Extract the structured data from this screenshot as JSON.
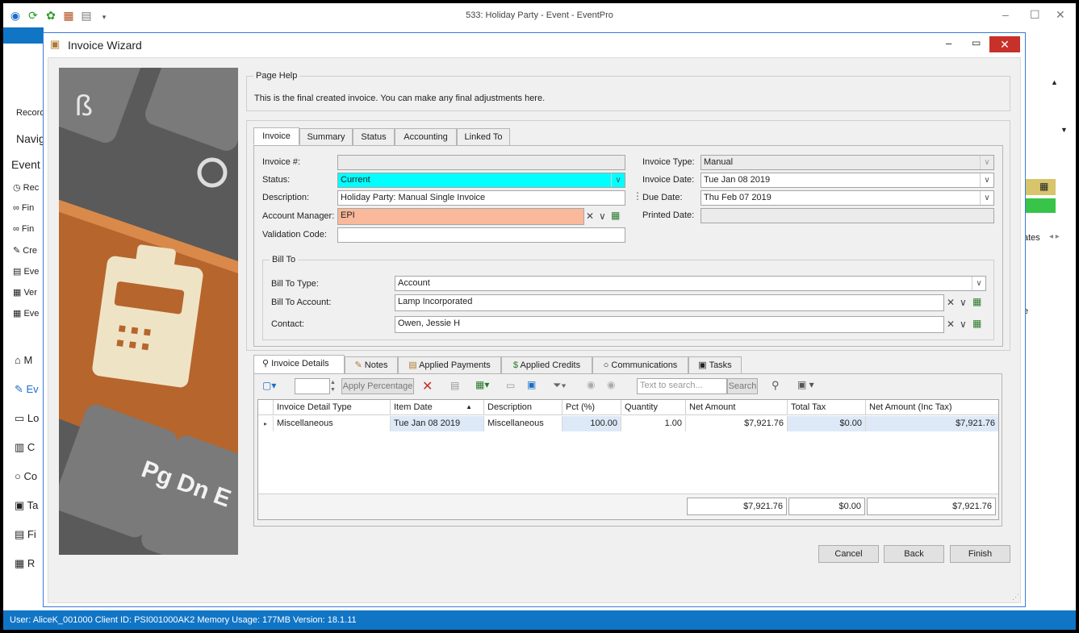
{
  "app": {
    "title": "533: Holiday Party - Event - EventPro",
    "left_fragments": [
      "Record",
      "Navig",
      "Event",
      "Rec",
      "Fin",
      "Fin",
      "Cre",
      "Eve",
      "Ver",
      "Eve",
      "M",
      "Ev",
      "Lo",
      "C",
      "Co",
      "Ta",
      "Fi",
      "R"
    ],
    "right_fragments": [
      "ates",
      "e"
    ]
  },
  "dialog": {
    "title": "Invoice Wizard"
  },
  "page_help": {
    "legend": "Page Help",
    "text": "This is the final created invoice.  You can make any final adjustments here."
  },
  "tabs": [
    "Invoice",
    "Summary",
    "Status",
    "Accounting",
    "Linked To"
  ],
  "invoice": {
    "invoice_no_label": "Invoice #:",
    "invoice_no": "",
    "status_label": "Status:",
    "status": "Current",
    "description_label": "Description:",
    "description": "Holiday Party: Manual Single Invoice",
    "manager_label": "Account Manager:",
    "manager": "EPI",
    "validation_label": "Validation Code:",
    "validation": "",
    "type_label": "Invoice Type:",
    "type": "Manual",
    "date_label": "Invoice Date:",
    "date": "Tue Jan 08 2019",
    "due_label": "Due Date:",
    "due": "Thu Feb 07 2019",
    "printed_label": "Printed Date:",
    "printed": ""
  },
  "bill_to": {
    "legend": "Bill To",
    "type_label": "Bill To Type:",
    "type": "Account",
    "account_label": "Bill To Account:",
    "account": "Lamp Incorporated",
    "contact_label": "Contact:",
    "contact": "Owen, Jessie H"
  },
  "detail_tabs": [
    "Invoice Details",
    "Notes",
    "Applied Payments",
    "Applied Credits",
    "Communications",
    "Tasks"
  ],
  "toolbar": {
    "apply_percentage": "Apply Percentage",
    "search_placeholder": "Text to search...",
    "search_button": "Search"
  },
  "grid": {
    "columns": [
      "Invoice Detail Type",
      "Item Date",
      "Description",
      "Pct (%)",
      "Quantity",
      "Net Amount",
      "Total Tax",
      "Net Amount (Inc Tax)"
    ],
    "rows": [
      [
        "Miscellaneous",
        "Tue Jan 08 2019",
        "Miscellaneous",
        "100.00",
        "1.00",
        "$7,921.76",
        "$0.00",
        "$7,921.76"
      ]
    ],
    "totals": {
      "net": "$7,921.76",
      "tax": "$0.00",
      "inc": "$7,921.76"
    }
  },
  "buttons": {
    "cancel": "Cancel",
    "back": "Back",
    "finish": "Finish"
  },
  "status": {
    "text": "User: AliceK_001000   Client ID: PSI001000AK2   Memory Usage: 177MB   Version: 18.1.11"
  },
  "colors": {
    "status_bg": "#00ffff",
    "manager_bg": "#f9b99a",
    "statusbar": "#1175c6",
    "close": "#c8302a"
  },
  "photo": {
    "keys": [
      "ß",
      "Pg Dn E"
    ]
  }
}
